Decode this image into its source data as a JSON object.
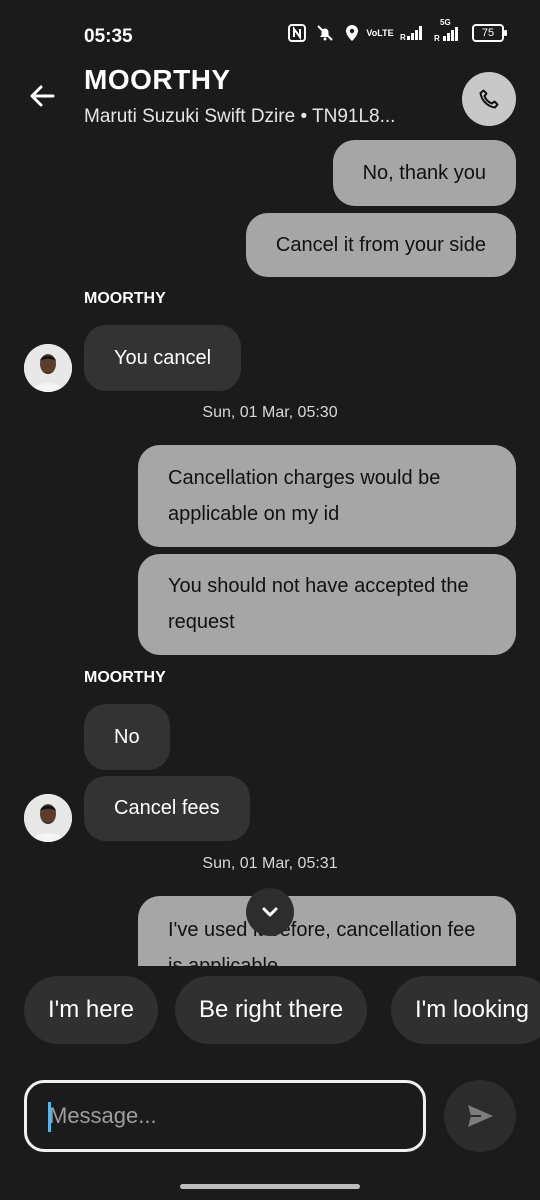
{
  "status_bar": {
    "time": "05:35",
    "icons": [
      "nfc-icon",
      "bell-muted-icon",
      "location-icon",
      "volte-icon",
      "signal-icon",
      "5g-signal-icon",
      "battery-icon"
    ],
    "volte_text": "VoLTE",
    "network_text": "5G",
    "battery": "75"
  },
  "header": {
    "contact_name": "MOORTHY",
    "vehicle": "Maruti Suzuki Swift Dzire • TN91L8..."
  },
  "messages": [
    {
      "type": "out",
      "text": "No, thank you"
    },
    {
      "type": "out",
      "text": "Cancel it from your side"
    },
    {
      "type": "sender",
      "text": "MOORTHY"
    },
    {
      "type": "in",
      "text": "You cancel"
    },
    {
      "type": "timestamp",
      "text": "Sun, 01 Mar, 05:30"
    },
    {
      "type": "out",
      "text": "Cancellation charges would be applicable on my id"
    },
    {
      "type": "out",
      "text": "You should not have accepted the request"
    },
    {
      "type": "sender",
      "text": "MOORTHY"
    },
    {
      "type": "in",
      "text": "No"
    },
    {
      "type": "in",
      "text": "Cancel fees"
    },
    {
      "type": "timestamp",
      "text": "Sun, 01 Mar, 05:31"
    },
    {
      "type": "out",
      "text": "I've used it before, cancellation fee is applicable"
    }
  ],
  "quick_replies": [
    "I'm here",
    "Be right there",
    "I'm looking"
  ],
  "composer": {
    "placeholder": "Message..."
  },
  "colors": {
    "background": "#1b1b1b",
    "outgoing_bubble": "#a6a6a6",
    "incoming_bubble": "#333333",
    "caret": "#59b7e6"
  }
}
